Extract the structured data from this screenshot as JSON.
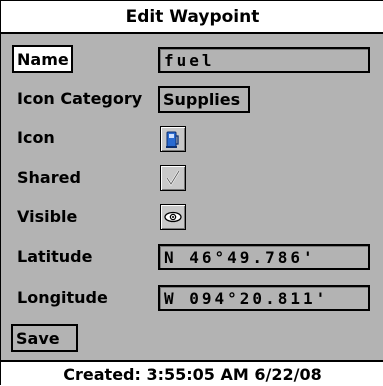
{
  "window": {
    "title": "Edit Waypoint"
  },
  "form": {
    "name_label": "Name",
    "name_value": "fuel",
    "icon_category_label": "Icon Category",
    "icon_category_value": "Supplies",
    "icon_label": "Icon",
    "icon_value": "fuel-pump-icon",
    "shared_label": "Shared",
    "shared_checked": true,
    "visible_label": "Visible",
    "visible_icon": "eye-icon",
    "latitude_label": "Latitude",
    "latitude_value": "N 46°49.786'",
    "longitude_label": "Longitude",
    "longitude_value": "W 094°20.811'"
  },
  "actions": {
    "save_label": "Save"
  },
  "footer": {
    "created": "Created: 3:55:05 AM 6/22/08"
  },
  "colors": {
    "panel": "#b3b3b3",
    "accent_blue": "#2a6bd1"
  }
}
